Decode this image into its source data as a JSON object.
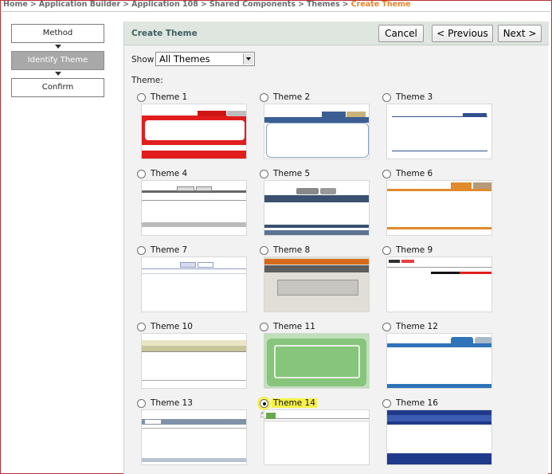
{
  "breadcrumb": {
    "items": [
      "Home",
      "Application Builder",
      "Application 108",
      "Shared Components",
      "Themes"
    ],
    "separator": ">",
    "current": "Create Theme"
  },
  "wizard": {
    "steps": [
      "Method",
      "Identify Theme",
      "Confirm"
    ],
    "active_index": 1
  },
  "panel": {
    "title": "Create Theme",
    "buttons": {
      "cancel": "Cancel",
      "previous": "< Previous",
      "next": "Next >"
    },
    "show_label": "Show",
    "show_value": "All Themes",
    "theme_label": "Theme:"
  },
  "themes": [
    {
      "name": "Theme 1",
      "selected": false
    },
    {
      "name": "Theme 2",
      "selected": false
    },
    {
      "name": "Theme 3",
      "selected": false
    },
    {
      "name": "Theme 4",
      "selected": false
    },
    {
      "name": "Theme 5",
      "selected": false
    },
    {
      "name": "Theme 6",
      "selected": false
    },
    {
      "name": "Theme 7",
      "selected": false
    },
    {
      "name": "Theme 8",
      "selected": false
    },
    {
      "name": "Theme 9",
      "selected": false
    },
    {
      "name": "Theme 10",
      "selected": false
    },
    {
      "name": "Theme 11",
      "selected": false
    },
    {
      "name": "Theme 12",
      "selected": false
    },
    {
      "name": "Theme 13",
      "selected": false
    },
    {
      "name": "Theme 14",
      "selected": true
    },
    {
      "name": "Theme 16",
      "selected": false
    }
  ],
  "colors": {
    "breadcrumb_current": "#e9822b",
    "panel_header": "#dfe6e0",
    "panel_title": "#3f5f62",
    "active_step": "#a8a8a8",
    "selection_highlight": "#f6f14a"
  }
}
